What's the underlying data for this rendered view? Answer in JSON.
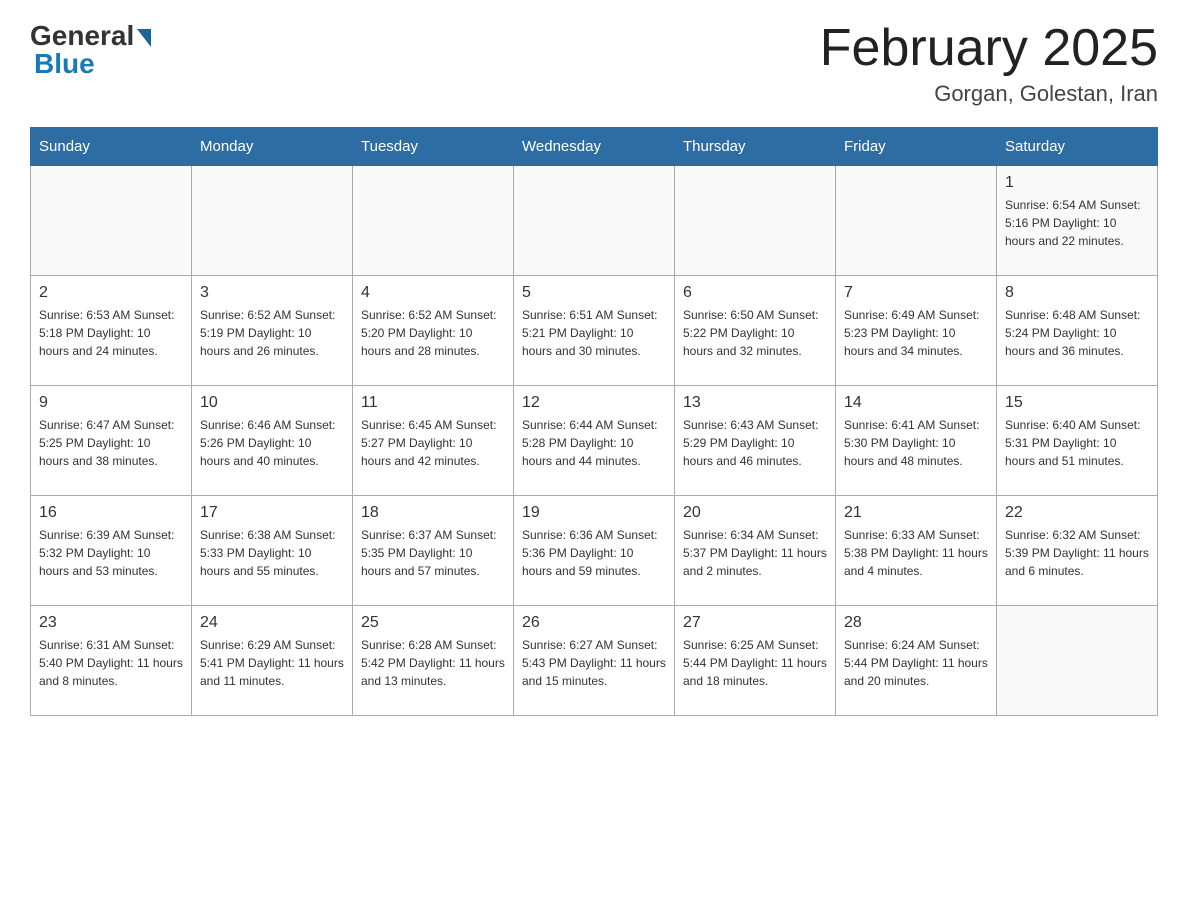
{
  "header": {
    "logo_general": "General",
    "logo_blue": "Blue",
    "month_title": "February 2025",
    "location": "Gorgan, Golestan, Iran"
  },
  "days_of_week": [
    "Sunday",
    "Monday",
    "Tuesday",
    "Wednesday",
    "Thursday",
    "Friday",
    "Saturday"
  ],
  "weeks": [
    [
      {
        "day": "",
        "info": ""
      },
      {
        "day": "",
        "info": ""
      },
      {
        "day": "",
        "info": ""
      },
      {
        "day": "",
        "info": ""
      },
      {
        "day": "",
        "info": ""
      },
      {
        "day": "",
        "info": ""
      },
      {
        "day": "1",
        "info": "Sunrise: 6:54 AM\nSunset: 5:16 PM\nDaylight: 10 hours and 22 minutes."
      }
    ],
    [
      {
        "day": "2",
        "info": "Sunrise: 6:53 AM\nSunset: 5:18 PM\nDaylight: 10 hours and 24 minutes."
      },
      {
        "day": "3",
        "info": "Sunrise: 6:52 AM\nSunset: 5:19 PM\nDaylight: 10 hours and 26 minutes."
      },
      {
        "day": "4",
        "info": "Sunrise: 6:52 AM\nSunset: 5:20 PM\nDaylight: 10 hours and 28 minutes."
      },
      {
        "day": "5",
        "info": "Sunrise: 6:51 AM\nSunset: 5:21 PM\nDaylight: 10 hours and 30 minutes."
      },
      {
        "day": "6",
        "info": "Sunrise: 6:50 AM\nSunset: 5:22 PM\nDaylight: 10 hours and 32 minutes."
      },
      {
        "day": "7",
        "info": "Sunrise: 6:49 AM\nSunset: 5:23 PM\nDaylight: 10 hours and 34 minutes."
      },
      {
        "day": "8",
        "info": "Sunrise: 6:48 AM\nSunset: 5:24 PM\nDaylight: 10 hours and 36 minutes."
      }
    ],
    [
      {
        "day": "9",
        "info": "Sunrise: 6:47 AM\nSunset: 5:25 PM\nDaylight: 10 hours and 38 minutes."
      },
      {
        "day": "10",
        "info": "Sunrise: 6:46 AM\nSunset: 5:26 PM\nDaylight: 10 hours and 40 minutes."
      },
      {
        "day": "11",
        "info": "Sunrise: 6:45 AM\nSunset: 5:27 PM\nDaylight: 10 hours and 42 minutes."
      },
      {
        "day": "12",
        "info": "Sunrise: 6:44 AM\nSunset: 5:28 PM\nDaylight: 10 hours and 44 minutes."
      },
      {
        "day": "13",
        "info": "Sunrise: 6:43 AM\nSunset: 5:29 PM\nDaylight: 10 hours and 46 minutes."
      },
      {
        "day": "14",
        "info": "Sunrise: 6:41 AM\nSunset: 5:30 PM\nDaylight: 10 hours and 48 minutes."
      },
      {
        "day": "15",
        "info": "Sunrise: 6:40 AM\nSunset: 5:31 PM\nDaylight: 10 hours and 51 minutes."
      }
    ],
    [
      {
        "day": "16",
        "info": "Sunrise: 6:39 AM\nSunset: 5:32 PM\nDaylight: 10 hours and 53 minutes."
      },
      {
        "day": "17",
        "info": "Sunrise: 6:38 AM\nSunset: 5:33 PM\nDaylight: 10 hours and 55 minutes."
      },
      {
        "day": "18",
        "info": "Sunrise: 6:37 AM\nSunset: 5:35 PM\nDaylight: 10 hours and 57 minutes."
      },
      {
        "day": "19",
        "info": "Sunrise: 6:36 AM\nSunset: 5:36 PM\nDaylight: 10 hours and 59 minutes."
      },
      {
        "day": "20",
        "info": "Sunrise: 6:34 AM\nSunset: 5:37 PM\nDaylight: 11 hours and 2 minutes."
      },
      {
        "day": "21",
        "info": "Sunrise: 6:33 AM\nSunset: 5:38 PM\nDaylight: 11 hours and 4 minutes."
      },
      {
        "day": "22",
        "info": "Sunrise: 6:32 AM\nSunset: 5:39 PM\nDaylight: 11 hours and 6 minutes."
      }
    ],
    [
      {
        "day": "23",
        "info": "Sunrise: 6:31 AM\nSunset: 5:40 PM\nDaylight: 11 hours and 8 minutes."
      },
      {
        "day": "24",
        "info": "Sunrise: 6:29 AM\nSunset: 5:41 PM\nDaylight: 11 hours and 11 minutes."
      },
      {
        "day": "25",
        "info": "Sunrise: 6:28 AM\nSunset: 5:42 PM\nDaylight: 11 hours and 13 minutes."
      },
      {
        "day": "26",
        "info": "Sunrise: 6:27 AM\nSunset: 5:43 PM\nDaylight: 11 hours and 15 minutes."
      },
      {
        "day": "27",
        "info": "Sunrise: 6:25 AM\nSunset: 5:44 PM\nDaylight: 11 hours and 18 minutes."
      },
      {
        "day": "28",
        "info": "Sunrise: 6:24 AM\nSunset: 5:44 PM\nDaylight: 11 hours and 20 minutes."
      },
      {
        "day": "",
        "info": ""
      }
    ]
  ]
}
